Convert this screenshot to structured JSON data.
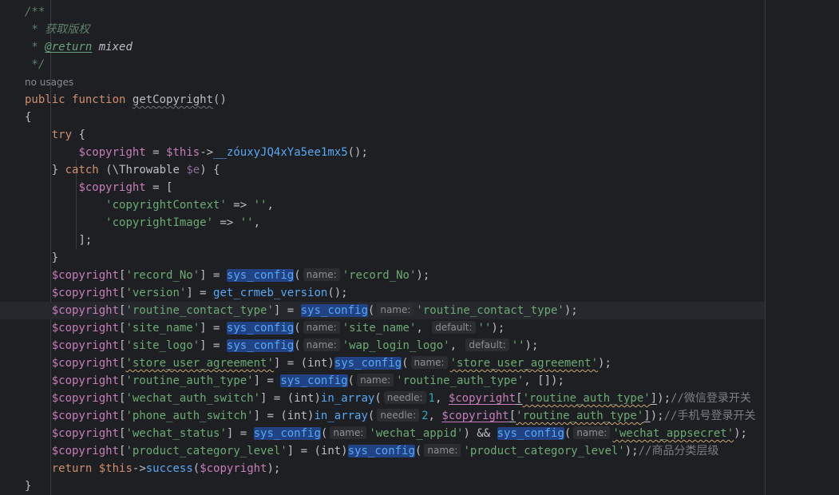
{
  "doc": {
    "open": "/**",
    "desc": " * 获取版权",
    "star": " * ",
    "tag": "@return",
    "type": " mixed",
    "close": " */"
  },
  "usages": "no usages",
  "sig": {
    "public": "public",
    "function": "function",
    "name": "getCopyright",
    "parens": "()"
  },
  "lines": {
    "lbrace": "{",
    "rbrace": "}",
    "try": "try",
    "catch": "catch",
    "throwable": "(\\Throwable ",
    "e": "$e",
    "obj_this": "$this",
    "arrow": "->",
    "obfuscated": "__zóuxyJQ4xYa5ee1mx5",
    "call_end": "();",
    "lbracket": "[",
    "rbracket_semi": "];",
    "ctx_key": "'copyrightContext'",
    "img_key": "'copyrightImage'",
    "fat_arrow": " => ",
    "empty": "''",
    "comma": ",",
    "return": "return",
    "success": "success",
    "sys_config": "sys_config",
    "get_version": "get_crmeb_version",
    "in_array": "in_array",
    "int_cast": "(int)",
    "and": " && ",
    "copyright": "$copyright"
  },
  "hints": {
    "name": "name:",
    "default": "default:",
    "needle": "needle:"
  },
  "keys": {
    "record_No": "'record_No'",
    "version": "'version'",
    "routine_contact_type": "'routine_contact_type'",
    "site_name": "'site_name'",
    "site_logo": "'site_logo'",
    "wap_login_logo": "'wap_login_logo'",
    "store_user_agreement": "'store_user_agreement'",
    "routine_auth_type": "'routine_auth_type'",
    "wechat_auth_switch": "'wechat_auth_switch'",
    "phone_auth_switch": "'phone_auth_switch'",
    "wechat_status": "'wechat_status'",
    "wechat_appid": "'wechat_appid'",
    "wechat_appsecret": "'wechat_appsecret'",
    "product_category_level": "'product_category_level'"
  },
  "nums": {
    "one": "1",
    "two": "2"
  },
  "comments": {
    "wechat_login": "//微信登录开关",
    "phone_login": "//手机号登录开关",
    "category_level": "//商品分类层级"
  },
  "colors": {
    "background": "#1e1f22",
    "keyword": "#cf8e6d",
    "function": "#56a8f5",
    "variable": "#c77dbb",
    "string": "#6aab73",
    "number": "#2aacb8",
    "comment": "#7a7e85",
    "highlight": "#214283"
  }
}
